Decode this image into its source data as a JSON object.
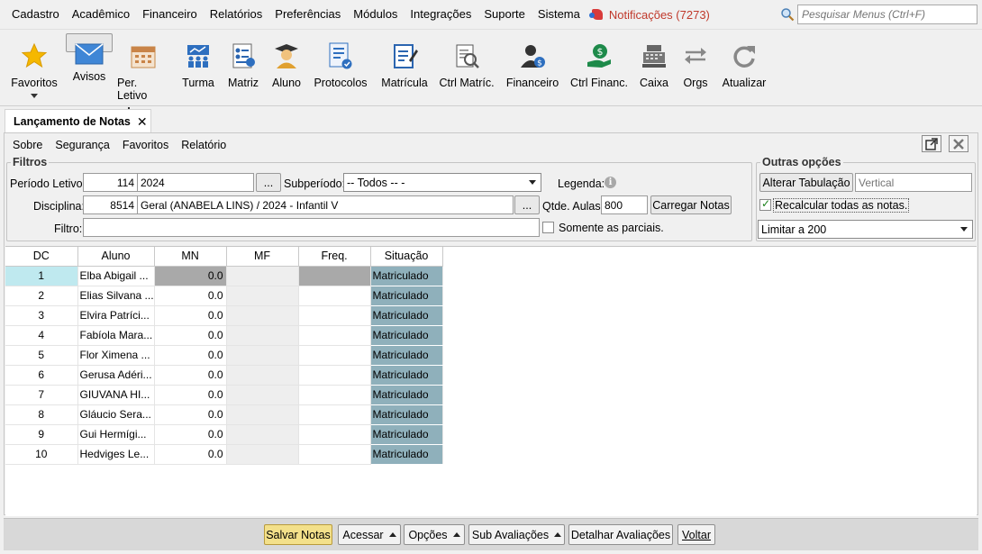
{
  "menu": {
    "items": [
      "Cadastro",
      "Acadêmico",
      "Financeiro",
      "Relatórios",
      "Preferências",
      "Módulos",
      "Integrações",
      "Suporte",
      "Sistema"
    ],
    "notifications": "Notificações (7273)",
    "search_placeholder": "Pesquisar Menus (Ctrl+F)"
  },
  "toolbar": {
    "favoritos": "Favoritos",
    "avisos": "Avisos",
    "per_letivo": "Per. Letivo",
    "turma": "Turma",
    "matriz": "Matriz",
    "aluno": "Aluno",
    "protocolos": "Protocolos",
    "matricula": "Matrícula",
    "ctrl_matric": "Ctrl Matríc.",
    "financeiro": "Financeiro",
    "ctrl_financ": "Ctrl Financ.",
    "caixa": "Caixa",
    "orgs": "Orgs",
    "atualizar": "Atualizar"
  },
  "tab": {
    "title": "Lançamento de Notas",
    "close": "✕"
  },
  "submenu": [
    "Sobre",
    "Segurança",
    "Favoritos",
    "Relatório"
  ],
  "filtros": {
    "legend": "Filtros",
    "periodo_label": "Período Letivo:",
    "periodo_code": "114",
    "periodo_value": "2024",
    "subperiodo_label": "Subperíodo:",
    "subperiodo_value": "-- Todos -- -",
    "legenda_label": "Legenda:",
    "disciplina_label": "Disciplina:",
    "disciplina_code": "8514",
    "disciplina_value": "Geral (ANABELA LINS) / 2024 - Infantil V",
    "qtde_label": "Qtde. Aulas:",
    "qtde_value": "800",
    "carregar": "Carregar Notas",
    "filtro_label": "Filtro:",
    "filtro_value": "",
    "parciais_label": "Somente as parciais.",
    "ellipsis": "..."
  },
  "outras": {
    "legend": "Outras opções",
    "alterar": "Alterar Tabulação",
    "vertical_placeholder": "Vertical",
    "recalcular": "Recalcular todas as notas.",
    "limitar": "Limitar a 200"
  },
  "grid": {
    "headers": [
      "DC",
      "Aluno",
      "MN",
      "MF",
      "Freq.",
      "Situação"
    ],
    "rows": [
      {
        "dc": "1",
        "aluno": "Elba Abigail ...",
        "mn": "0.0",
        "mf": "",
        "freq": "",
        "sit": "Matriculado"
      },
      {
        "dc": "2",
        "aluno": "Elias Silvana ...",
        "mn": "0.0",
        "mf": "",
        "freq": "",
        "sit": "Matriculado"
      },
      {
        "dc": "3",
        "aluno": "Elvira Patríci...",
        "mn": "0.0",
        "mf": "",
        "freq": "",
        "sit": "Matriculado"
      },
      {
        "dc": "4",
        "aluno": "Fabíola Mara...",
        "mn": "0.0",
        "mf": "",
        "freq": "",
        "sit": "Matriculado"
      },
      {
        "dc": "5",
        "aluno": "Flor Ximena ...",
        "mn": "0.0",
        "mf": "",
        "freq": "",
        "sit": "Matriculado"
      },
      {
        "dc": "6",
        "aluno": "Gerusa Adéri...",
        "mn": "0.0",
        "mf": "",
        "freq": "",
        "sit": "Matriculado"
      },
      {
        "dc": "7",
        "aluno": "GIUVANA HI...",
        "mn": "0.0",
        "mf": "",
        "freq": "",
        "sit": "Matriculado"
      },
      {
        "dc": "8",
        "aluno": "Gláucio Sera...",
        "mn": "0.0",
        "mf": "",
        "freq": "",
        "sit": "Matriculado"
      },
      {
        "dc": "9",
        "aluno": "Gui Hermígi...",
        "mn": "0.0",
        "mf": "",
        "freq": "",
        "sit": "Matriculado"
      },
      {
        "dc": "10",
        "aluno": "Hedviges Le...",
        "mn": "0.0",
        "mf": "",
        "freq": "",
        "sit": "Matriculado"
      }
    ]
  },
  "bottom": {
    "salvar": "Salvar Notas",
    "acessar": "Acessar",
    "opcoes": "Opções",
    "sub_avaliacoes": "Sub Avaliações",
    "detalhar": "Detalhar Avaliações",
    "voltar": "Voltar"
  },
  "colors": {
    "situacao_bg": "#8fb0bb",
    "selected_row": "#bfe9ef",
    "highlight_button": "#f3e08a",
    "notifications": "#c0392b"
  }
}
